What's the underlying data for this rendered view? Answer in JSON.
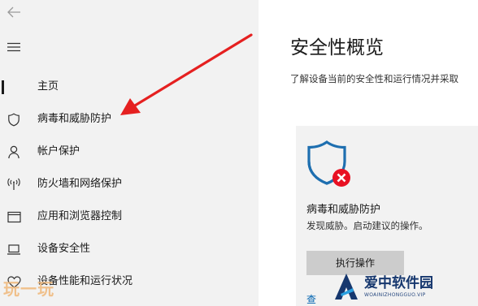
{
  "sidebar": {
    "items": [
      {
        "label": "主页",
        "icon": "home-icon",
        "selected": true
      },
      {
        "label": "病毒和威胁防护",
        "icon": "shield-icon",
        "selected": false
      },
      {
        "label": "帐户保护",
        "icon": "person-icon",
        "selected": false
      },
      {
        "label": "防火墙和网络保护",
        "icon": "wifi-antenna-icon",
        "selected": false
      },
      {
        "label": "应用和浏览器控制",
        "icon": "browser-window-icon",
        "selected": false
      },
      {
        "label": "设备安全性",
        "icon": "laptop-icon",
        "selected": false
      },
      {
        "label": "设备性能和运行状况",
        "icon": "heart-icon",
        "selected": false
      }
    ]
  },
  "main": {
    "title": "安全性概览",
    "subtitle": "了解设备当前的安全性和运行情况并采取",
    "card": {
      "icon": "shield-warning-icon",
      "title": "病毒和威胁防护",
      "description": "发现威胁。启动建议的操作。",
      "button_label": "执行操作",
      "link_text": "查"
    }
  },
  "watermarks": {
    "left_text": "玩一玩",
    "right_cn": "爱中软件园",
    "right_en": "WOAINIZHONGGUO.VIP"
  },
  "colors": {
    "sidebar_bg": "#f2f2f2",
    "card_bg": "#f2f2f2",
    "shield_blue": "#1e6fb0",
    "error_red": "#e81123",
    "annotation_arrow": "#e52020",
    "link_blue": "#0063b1"
  }
}
